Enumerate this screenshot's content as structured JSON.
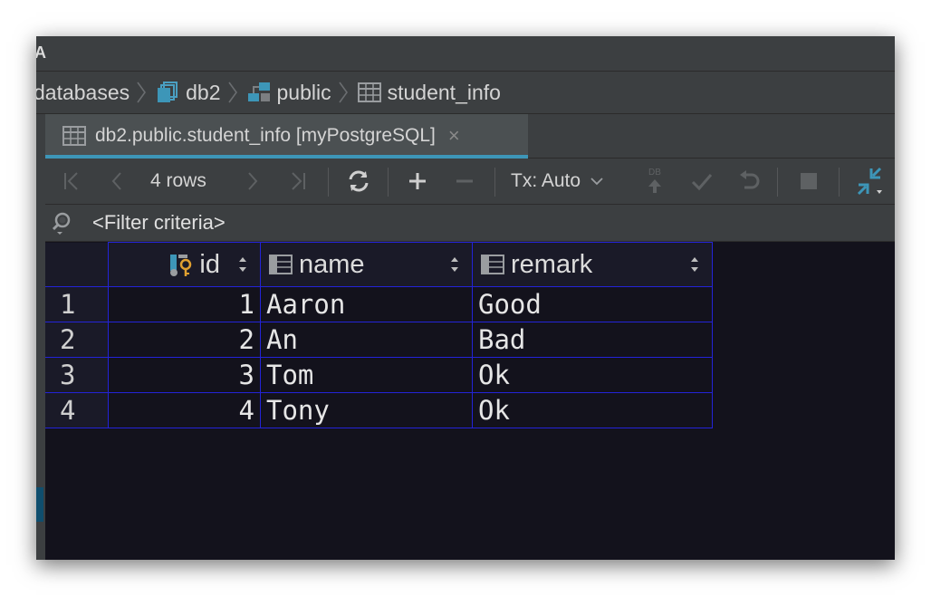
{
  "breadcrumb": {
    "items": [
      {
        "label": "databases",
        "icon": null
      },
      {
        "label": "db2",
        "icon": "database-icon"
      },
      {
        "label": "public",
        "icon": "schema-icon"
      },
      {
        "label": "student_info",
        "icon": "table-icon"
      }
    ]
  },
  "tab": {
    "title": "db2.public.student_info [myPostgreSQL]",
    "icon": "table-icon",
    "close": "×"
  },
  "toolbar": {
    "row_count": "4 rows",
    "tx_mode": "Tx: Auto",
    "db_badge": "DB"
  },
  "filter": {
    "placeholder": "<Filter criteria>"
  },
  "table": {
    "columns": [
      {
        "name": "id",
        "icon": "primary-key-column-icon"
      },
      {
        "name": "name",
        "icon": "column-icon"
      },
      {
        "name": "remark",
        "icon": "column-icon"
      }
    ],
    "rows": [
      {
        "num": "1",
        "id": "1",
        "name": "Aaron",
        "remark": "Good"
      },
      {
        "num": "2",
        "id": "2",
        "name": "An",
        "remark": "Bad"
      },
      {
        "num": "3",
        "id": "3",
        "name": "Tom",
        "remark": "Ok"
      },
      {
        "num": "4",
        "id": "4",
        "name": "Tony",
        "remark": "Ok"
      }
    ]
  },
  "colors": {
    "grid_border": "#2323d8",
    "grid_background": "#13121c",
    "tab_underline": "#3d96b8",
    "accent_icon": "#3d96b8"
  }
}
